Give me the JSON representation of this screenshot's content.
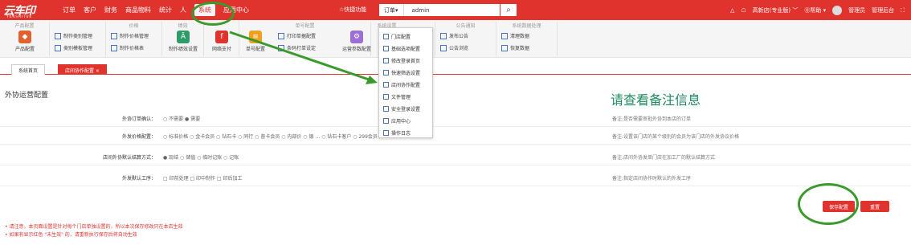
{
  "header": {
    "logo": "云车印",
    "logo_sub": "YUNSHITUE",
    "nav": [
      "订单",
      "客户",
      "财务",
      "商品物料",
      "统计",
      "人",
      "系统",
      "应用中心"
    ],
    "quick": "☆快捷功能",
    "search_select": "订单▾",
    "search_value": "admin",
    "right": [
      "△",
      "☖",
      "高新店(专业版) ﹀",
      "⓪帮助 ▾",
      "管理员",
      "管理后台",
      "⛶"
    ]
  },
  "ribbon": {
    "groups": [
      "产品配置",
      "价格",
      "绩效",
      "",
      "单号配置",
      "系统设置",
      "公告通知",
      "系统数据处理"
    ],
    "big": [
      "产品配置",
      "制作绩效设置",
      "网络支付",
      "单号配置",
      "运营参数配置"
    ],
    "small": [
      "制作类别管理",
      "类别模板管理",
      "制作价格管理",
      "制作价格表",
      "打印单据配置",
      "条码打单设定",
      "发布公告",
      "公告浏览",
      "清理数据",
      "恢复数据"
    ]
  },
  "dropdown": [
    "门店配置",
    "基础选项配置",
    "修改登录首页",
    "快速筛选设置",
    "店间协作配置",
    "文件管理",
    "安全登录设置",
    "应用中心",
    "操作日志"
  ],
  "tabs": [
    "系统首页",
    "店间协作配置 ×"
  ],
  "page": {
    "title": "外协运营配置",
    "big_note": "请查看备注信息"
  },
  "form": [
    {
      "label": "外协订单确认：",
      "opts": "○ 不需要  ● 需要",
      "note": "备注:是否需要审批外协到本店的订单"
    },
    {
      "label": "外发价格配置：",
      "opts": "○ 标准价格  ○ 金卡会员  ○ 钻石卡  ○ 同行  ○ 普卡会员  ○ 内部价  ○ 银 … ○ 钻石卡客户  ○ 299会员卡",
      "note": "备注:设置该门店的某个级别的会员为该门店的外发协议价格"
    },
    {
      "label": "店间外协默认结算方式：",
      "opts": "● 现结  ○ 储值  ○ 临时记账  ○ 记账",
      "note": "备注:店间外协发单门店在加工厂的默认结算方式"
    },
    {
      "label": "外发默认工序：",
      "opts": "□ 印前处理  □ 印中制作  □ 印后加工",
      "note": "备注:指定店间协作时默认的外发工序"
    }
  ],
  "buttons": {
    "save": "保存配置",
    "reset": "重置"
  },
  "notes": [
    "• 请注意，本页面设置是针对每个门店单独设置的，所以本次保存修改只在本店生效",
    "• 如果有显示红色 \"未生效\" 的，请重新执行保存后将自动生效"
  ]
}
